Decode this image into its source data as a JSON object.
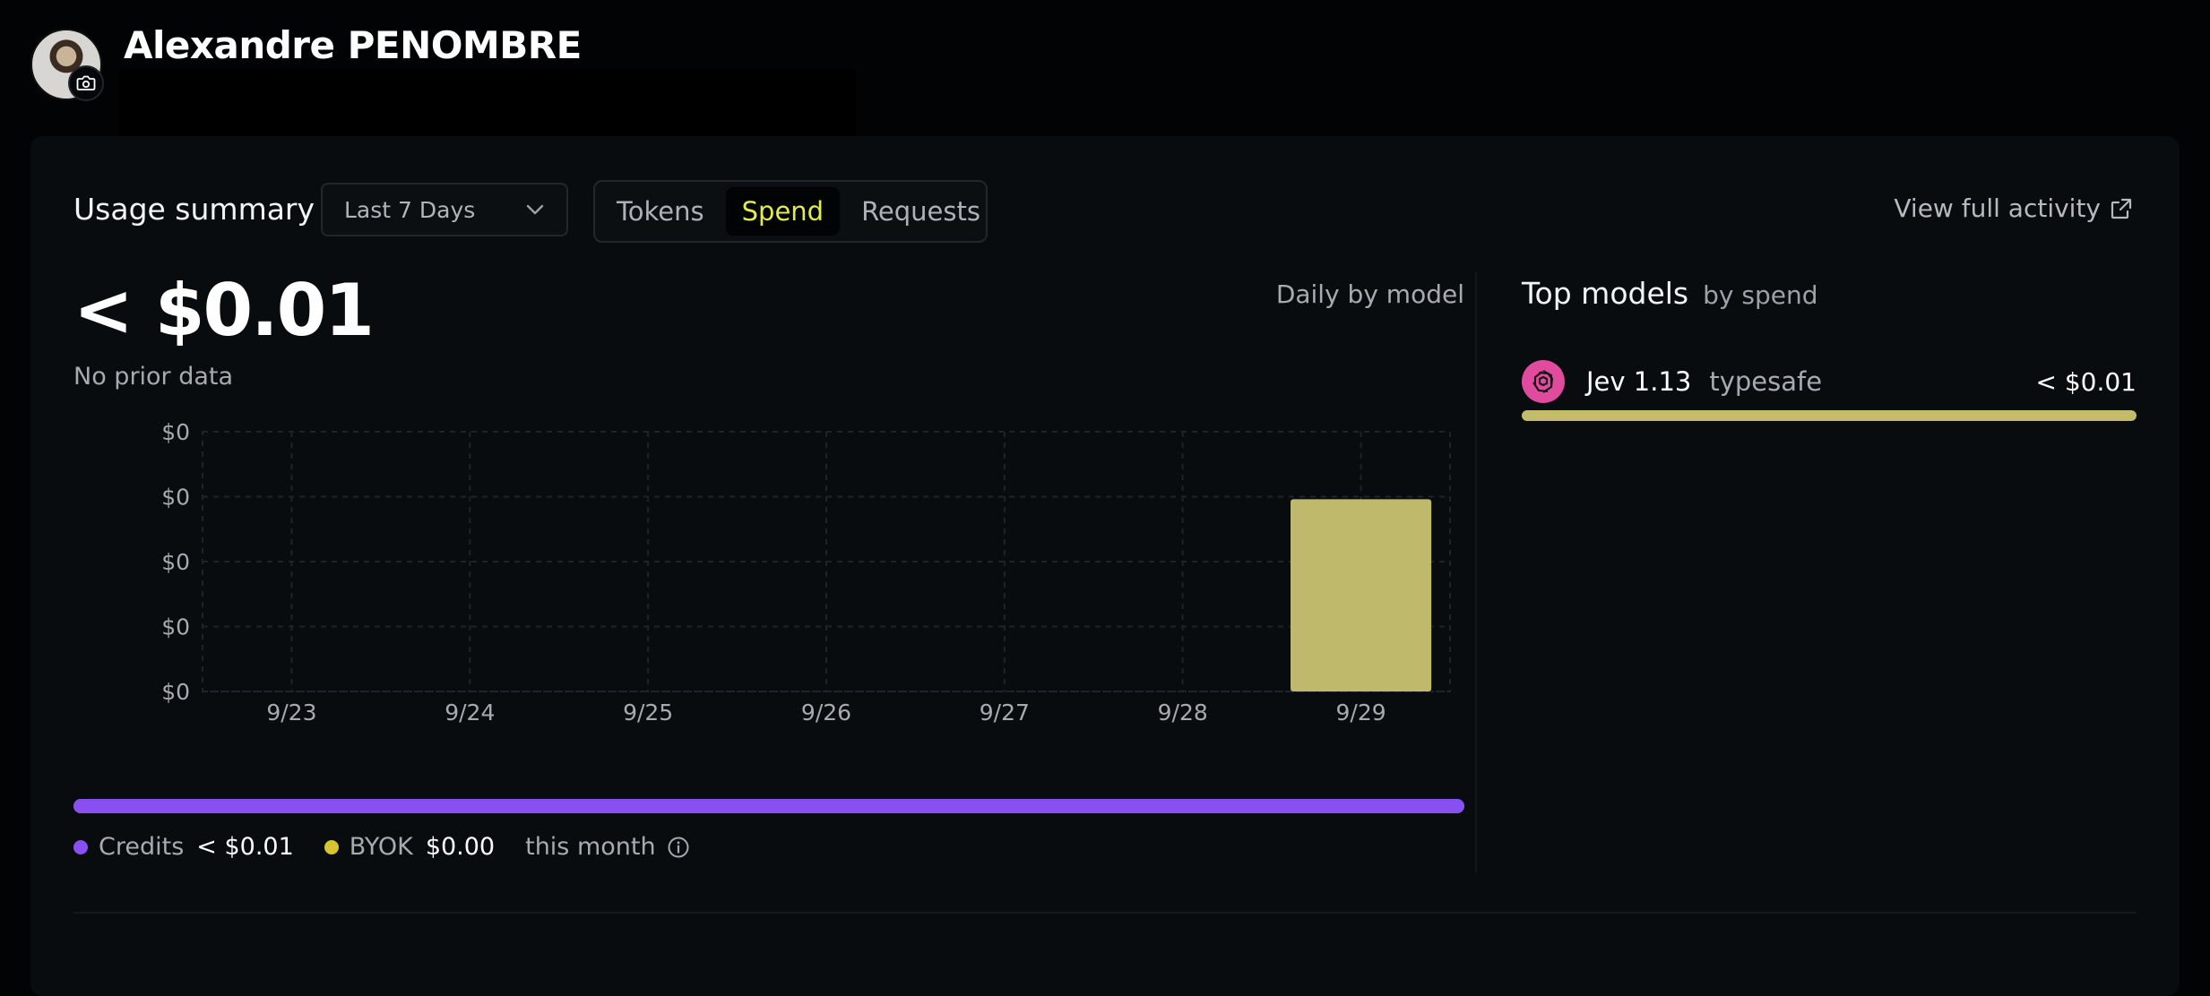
{
  "profile": {
    "name": "Alexandre PENOMBRE"
  },
  "usage": {
    "title": "Usage summary",
    "range": "Last 7 Days",
    "tabs": [
      "Tokens",
      "Spend",
      "Requests"
    ],
    "active_tab": "Spend",
    "view_full": "View full activity",
    "total": "< $0.01",
    "comparison": "No prior data",
    "chart_label": "Daily by model"
  },
  "chart_data": {
    "type": "bar",
    "categories": [
      "9/23",
      "9/24",
      "9/25",
      "9/26",
      "9/27",
      "9/28",
      "9/29"
    ],
    "y_tick_labels": [
      "$0",
      "$0",
      "$0",
      "$0",
      "$0"
    ],
    "values": [
      0,
      0,
      0,
      0,
      0,
      0,
      0.74
    ],
    "ylim": [
      0,
      1
    ],
    "grid": true,
    "bar_color": "#bfb96c"
  },
  "split": {
    "credits_label": "Credits",
    "credits_value": "< $0.01",
    "credits_color": "#8a4ff0",
    "byok_label": "BYOK",
    "byok_value": "$0.00",
    "byok_color": "#d7c52f",
    "period": "this month",
    "credits_fraction": 1.0
  },
  "top_models": {
    "title": "Top models",
    "subtitle": "by spend",
    "items": [
      {
        "name": "Jev 1.13",
        "provider": "typesafe",
        "amount": "< $0.01",
        "icon": "openai-icon",
        "share": 1.0
      }
    ]
  }
}
